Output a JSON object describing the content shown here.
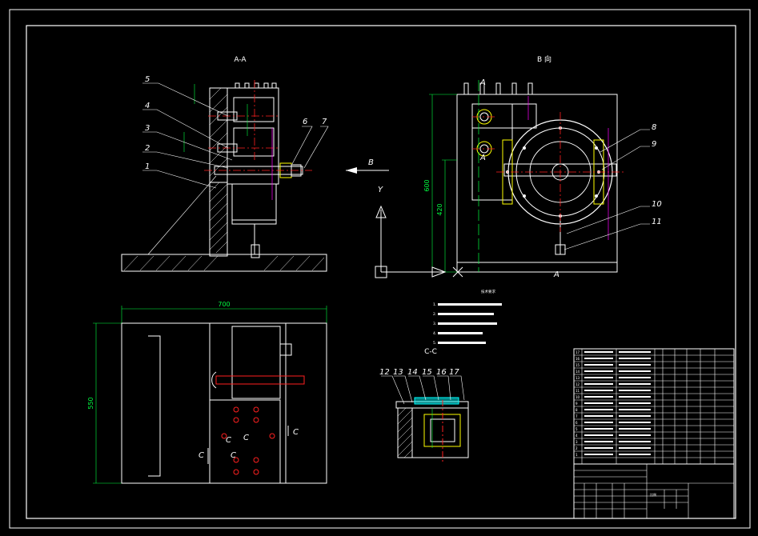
{
  "views": {
    "section_aa": "A-A",
    "view_b": "B 向",
    "section_cc": "C-C"
  },
  "part_labels": {
    "p1": "1",
    "p2": "2",
    "p3": "3",
    "p4": "4",
    "p5": "5",
    "p6": "6",
    "p7": "7",
    "p8": "8",
    "p9": "9",
    "p10": "10",
    "p11": "11",
    "p12": "12",
    "p13": "13",
    "p14": "14",
    "p15": "15",
    "p16": "16",
    "p17": "17"
  },
  "dimensions": {
    "width_700": "700",
    "depth_550": "550",
    "height_600": "600",
    "height_420": "420"
  },
  "markers": {
    "arrow_b": "B",
    "axis_y": "Y",
    "section_a_top": "A",
    "section_a_bottom": "A",
    "section_a_center": "A",
    "section_c1": "C",
    "section_c2": "C",
    "section_c3": "C",
    "section_c4": "C",
    "section_c5": "C"
  },
  "tech_notes": {
    "heading": "技术要求",
    "items": [
      "1.",
      "2.",
      "3.",
      "4.",
      "5."
    ]
  },
  "bom_rows": [
    "17",
    "16",
    "15",
    "14",
    "13",
    "12",
    "11",
    "10",
    "9",
    "8",
    "7",
    "6",
    "5",
    "4",
    "3",
    "2",
    "1"
  ],
  "title_block": {
    "scale_label": "比例"
  },
  "colors": {
    "outline": "#ffffff",
    "dimension": "#00ff40",
    "centerline": "#ff2020",
    "hidden": "#ff00ff",
    "highlight": "#ffff00",
    "accent": "#00ffff"
  }
}
